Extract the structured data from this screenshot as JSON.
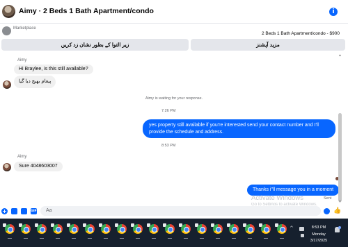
{
  "header": {
    "title": "Aimy · 2 Beds 1 Bath Apartment/condo",
    "info_glyph": "i"
  },
  "marketplace": {
    "label": "Marketplace",
    "listing": "2 Beds 1 Bath Apartment/condo - $900",
    "buttons": [
      "زیر التوا کے بطور نشان زد کریں",
      "مزید آپشنز"
    ]
  },
  "chat": {
    "messages": [
      {
        "sender": "Aimy",
        "text": "Hi Braylee, is this still available?",
        "direction": "in"
      },
      {
        "text": "پیغام بھیج دیا گیا",
        "direction": "in"
      },
      {
        "system": "Aimy is waiting for your response."
      },
      {
        "time": "7:26 PM"
      },
      {
        "text_lines": [
          "yes property still available if you're interested send your contact number and I'll",
          "provide the schedule and address."
        ],
        "direction": "out"
      },
      {
        "time": "8:53 PM"
      },
      {
        "sender": "Aimy",
        "text": "Sure 4048603007",
        "direction": "in"
      },
      {
        "text": "Thanks i\"ll message you in a moment",
        "direction": "out",
        "status": "Sent"
      }
    ],
    "watermark": {
      "title": "Activate Windows",
      "subtitle": "Go to Settings to activate Windows."
    }
  },
  "composer": {
    "placeholder": "Aa",
    "plus_glyph": "+",
    "gif_label": "GIF",
    "like_glyph": "👍"
  },
  "taskbar": {
    "app_count": 18,
    "app_icon": "chrome-icon",
    "tray_up_glyph": "^",
    "clock": {
      "time": "8:53 PM",
      "day": "Monday",
      "date": "3/17/2025"
    }
  },
  "colors": {
    "accent": "#0866ff",
    "incoming_bubble": "#f0f0f0",
    "taskbar": "#16202e"
  }
}
